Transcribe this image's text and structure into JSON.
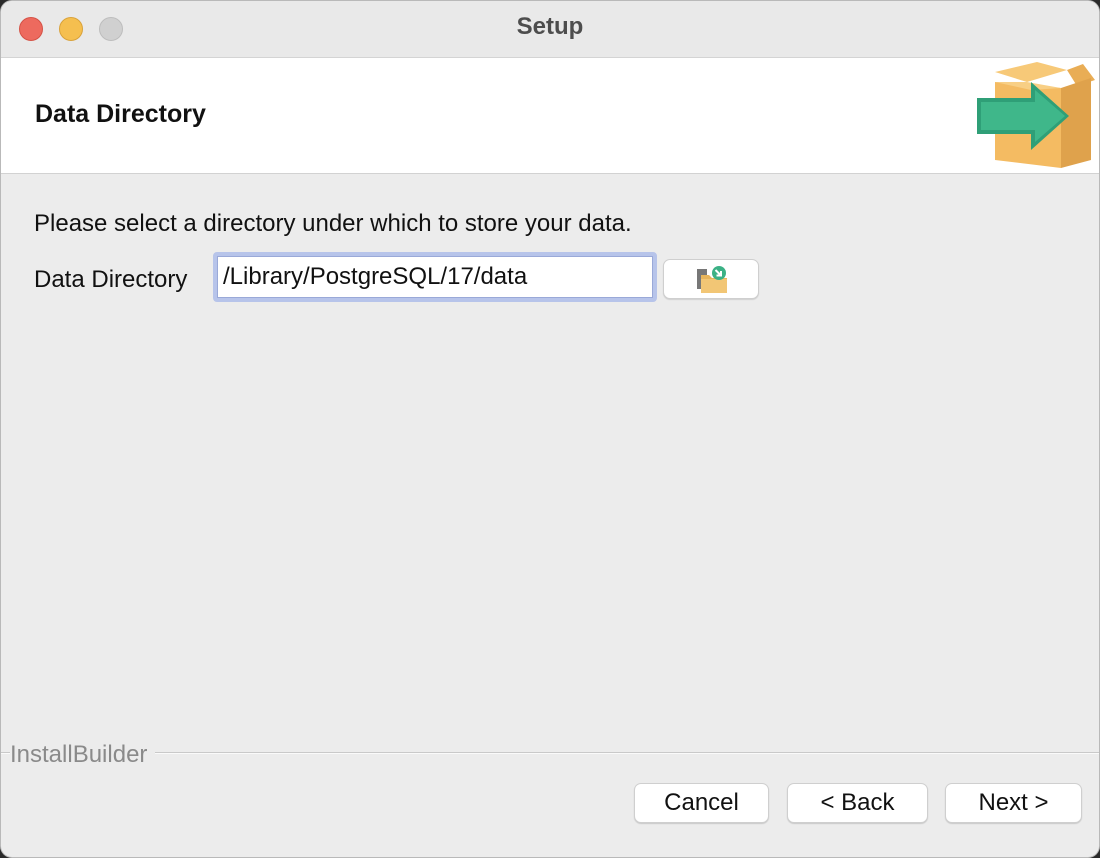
{
  "window": {
    "title": "Setup"
  },
  "header": {
    "title": "Data Directory",
    "logo_icon": "installer-box-arrow-icon"
  },
  "content": {
    "instruction": "Please select a directory under which to store your data.",
    "data_directory": {
      "label": "Data Directory",
      "value": "/Library/PostgreSQL/17/data",
      "browse_icon": "folder-browse-icon"
    }
  },
  "footer": {
    "brand": "InstallBuilder",
    "buttons": {
      "cancel": "Cancel",
      "back": "< Back",
      "next": "Next >"
    }
  },
  "colors": {
    "close": "#ed6a5e",
    "minimize": "#f5bf4f",
    "zoom": "#d0d0d0",
    "box": "#f2b85e",
    "arrow": "#3bb185",
    "input_focus": "#b7c4ea"
  }
}
